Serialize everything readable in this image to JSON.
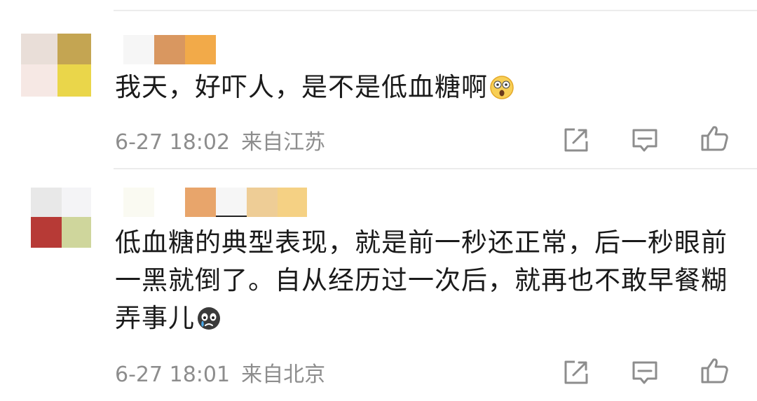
{
  "comments": [
    {
      "text": "我天，好吓人，是不是低血糖啊",
      "emoji": "astonished-face-emoji",
      "date": "6-27 18:02",
      "location": "来自江苏",
      "actions": [
        "share-icon",
        "reply-icon",
        "like-icon"
      ]
    },
    {
      "text": "低血糖的典型表现，就是前一秒还正常，后一秒眼前一黑就倒了。自从经历过一次后，就再也不敢早餐糊弄事儿",
      "emoji": "crying-face-emoji",
      "date": "6-27 18:01",
      "location": "来自北京",
      "actions": [
        "share-icon",
        "reply-icon",
        "like-icon"
      ]
    }
  ],
  "colors": {
    "text": "#1a1a1a",
    "meta": "#8d8d8d",
    "icon": "#8d8d8d",
    "divider": "#ececec"
  }
}
